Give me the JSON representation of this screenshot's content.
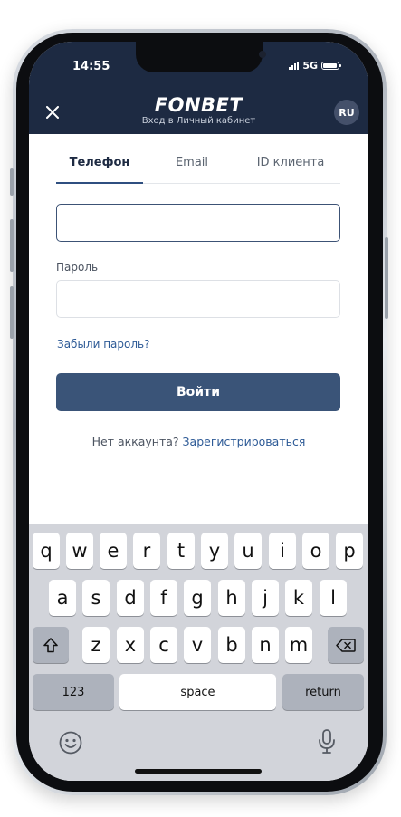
{
  "status_bar": {
    "time": "14:55",
    "network": "5G"
  },
  "header": {
    "brand": "FONBET",
    "subtitle": "Вход в Личный кабинет",
    "language": "RU"
  },
  "tabs": [
    {
      "label": "Телефон",
      "active": true
    },
    {
      "label": "Email",
      "active": false
    },
    {
      "label": "ID клиента",
      "active": false
    }
  ],
  "form": {
    "phone_value": "",
    "password_label": "Пароль",
    "password_value": "",
    "forgot_link": "Забыли пароль?",
    "login_button": "Войти",
    "no_account_text": "Нет аккаунта?",
    "register_link": "Зарегистрироваться"
  },
  "keyboard": {
    "row1": [
      "q",
      "w",
      "e",
      "r",
      "t",
      "y",
      "u",
      "i",
      "o",
      "p"
    ],
    "row2": [
      "a",
      "s",
      "d",
      "f",
      "g",
      "h",
      "j",
      "k",
      "l"
    ],
    "row3": [
      "z",
      "x",
      "c",
      "v",
      "b",
      "n",
      "m"
    ],
    "numbers_key": "123",
    "space_key": "space",
    "return_key": "return"
  },
  "colors": {
    "header_bg": "#1d2a42",
    "accent": "#3a5478",
    "link": "#2d5a96"
  }
}
